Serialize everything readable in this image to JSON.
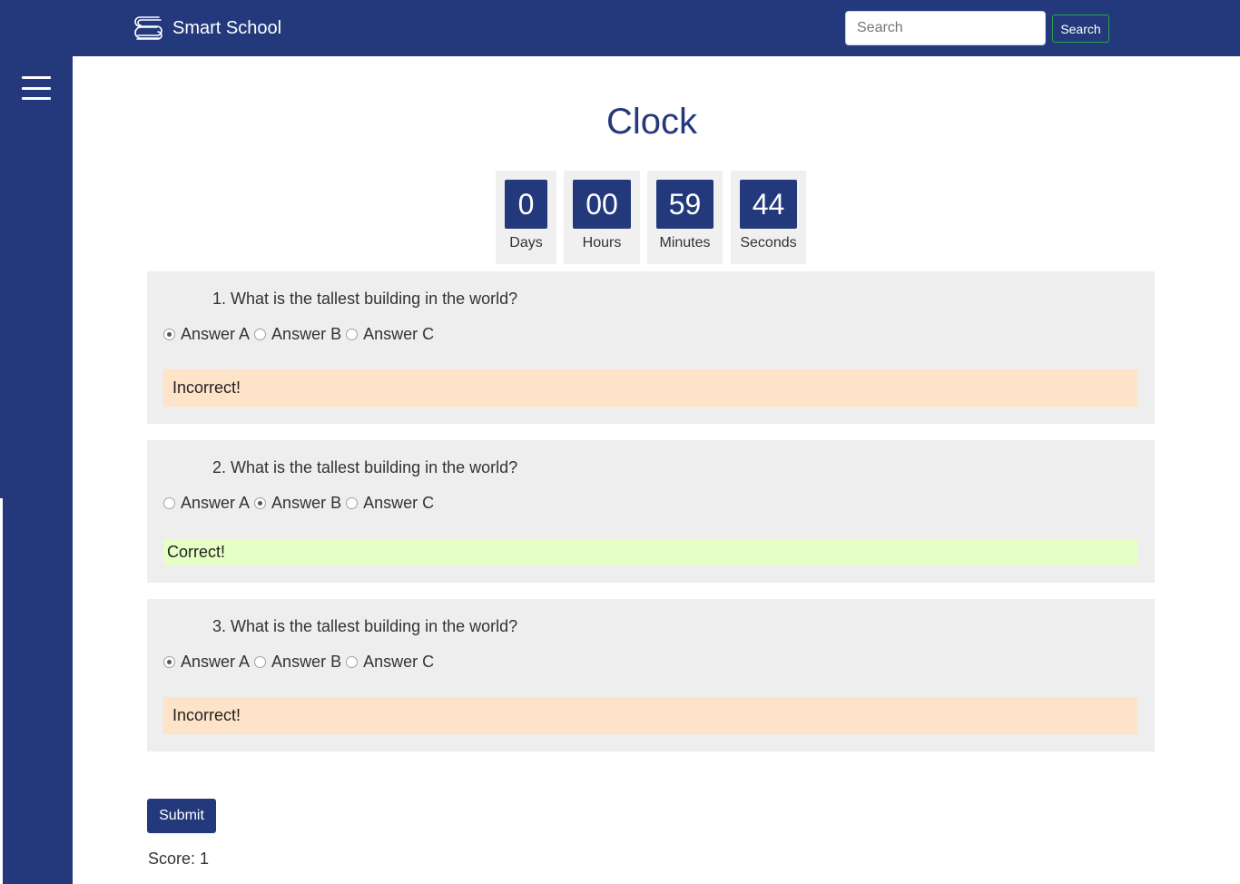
{
  "navbar": {
    "brand": "Smart School",
    "search_placeholder": "Search",
    "search_button": "Search"
  },
  "page": {
    "title": "Clock"
  },
  "clock": [
    {
      "value": "0",
      "label": "Days"
    },
    {
      "value": "00",
      "label": "Hours"
    },
    {
      "value": "59",
      "label": "Minutes"
    },
    {
      "value": "44",
      "label": "Seconds"
    }
  ],
  "questions": [
    {
      "text": "1. What is the tallest building in the world?",
      "answers": [
        "Answer A",
        "Answer B",
        "Answer C"
      ],
      "selected": 0,
      "feedback": "Incorrect!",
      "status": "incorrect"
    },
    {
      "text": "2. What is the tallest building in the world?",
      "answers": [
        "Answer A",
        "Answer B",
        "Answer C"
      ],
      "selected": 1,
      "feedback": "Correct!",
      "status": "correct"
    },
    {
      "text": "3. What is the tallest building in the world?",
      "answers": [
        "Answer A",
        "Answer B",
        "Answer C"
      ],
      "selected": 0,
      "feedback": "Incorrect!",
      "status": "incorrect"
    }
  ],
  "submit_label": "Submit",
  "score": "Score: 1",
  "colors": {
    "primary": "#24397c",
    "incorrect_bg": "#fde3c8",
    "correct_bg": "#e5ffc4",
    "card_bg": "#eeeeee"
  }
}
